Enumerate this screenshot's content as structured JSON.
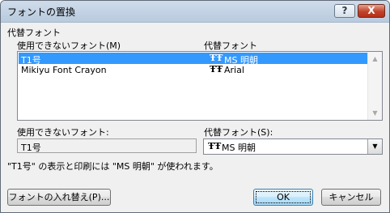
{
  "window": {
    "title": "フォントの置換",
    "help_label": "?",
    "close_label": "X"
  },
  "group_title": "代替フォント",
  "list": {
    "col_unavailable": "使用できないフォント(M)",
    "col_substitute": "代替フォント",
    "rows": [
      {
        "font": "T1号",
        "substitute": "MS 明朝",
        "icon": "truetype-font-icon",
        "selected": true
      },
      {
        "font": "Mikiyu Font Crayon",
        "substitute": "Arial",
        "icon": "truetype-font-icon",
        "selected": false
      }
    ]
  },
  "detail": {
    "unavailable_label": "使用できないフォント:",
    "unavailable_value": "T1号",
    "substitute_label": "代替フォント(S):",
    "substitute_value": "MS 明朝"
  },
  "message": "\"T1号\" の表示と印刷には \"MS 明朝\" が使われます。",
  "buttons": {
    "replace": "フォントの入れ替え(P)...",
    "ok": "OK",
    "cancel": "キャンセル"
  },
  "icons": {
    "truetype_glyph": "ŦŦ",
    "scroll_up": "▲",
    "scroll_down": "▼",
    "combo_arrow": "▼"
  },
  "colors": {
    "selection": "#3399ff",
    "close_button": "#c0432a"
  }
}
